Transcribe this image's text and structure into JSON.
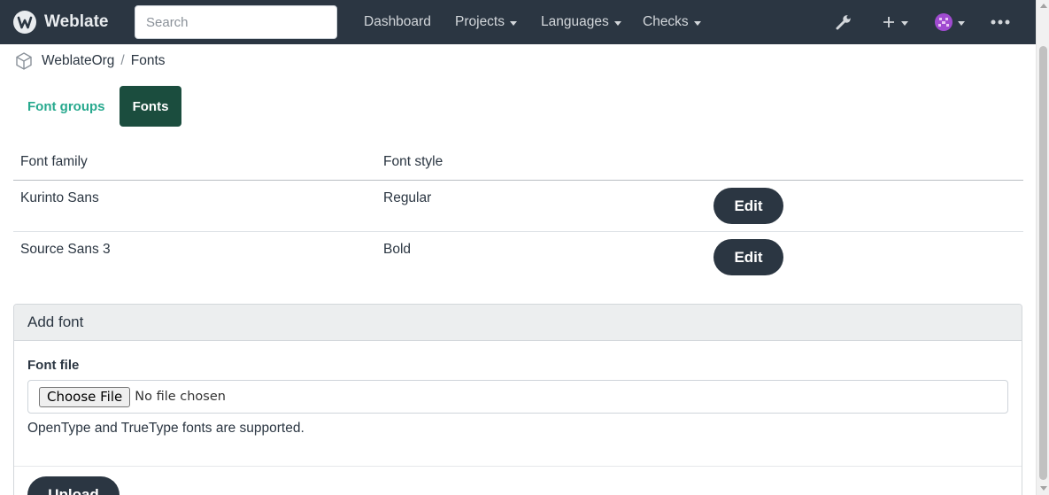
{
  "navbar": {
    "brand": "Weblate",
    "search_placeholder": "Search",
    "items": [
      {
        "label": "Dashboard"
      },
      {
        "label": "Projects"
      },
      {
        "label": "Languages"
      },
      {
        "label": "Checks"
      }
    ],
    "icons": [
      "wrench-icon",
      "plus-icon",
      "avatar",
      "more-icon"
    ]
  },
  "breadcrumb": {
    "project": "WeblateOrg",
    "page": "Fonts"
  },
  "tabs": [
    {
      "label": "Font groups"
    },
    {
      "label": "Fonts"
    }
  ],
  "table": {
    "headers": [
      "Font family",
      "Font style"
    ],
    "rows": [
      {
        "family": "Kurinto Sans",
        "style": "Regular",
        "action": "Edit"
      },
      {
        "family": "Source Sans 3",
        "style": "Bold",
        "action": "Edit"
      }
    ]
  },
  "add_font": {
    "title": "Add font",
    "field_label": "Font file",
    "choose_button": "Choose File",
    "no_file": "No file chosen",
    "help": "OpenType and TrueType fonts are supported.",
    "submit": "Upload"
  },
  "colors": {
    "navbar": "#2b3642",
    "accent": "#1b4d3e",
    "link": "#27a98e"
  }
}
